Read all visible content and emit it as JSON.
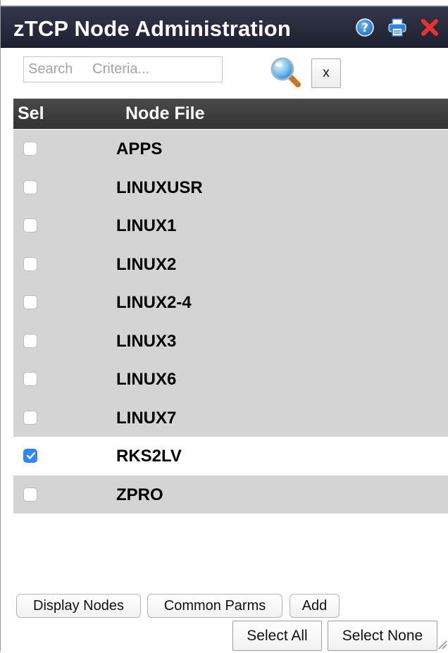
{
  "window": {
    "title": "zTCP Node Administration",
    "titlebar_icons": [
      "help-icon",
      "print-icon",
      "close-icon"
    ]
  },
  "search": {
    "placeholder": "Search     Criteria...",
    "value": "",
    "clear_label": "x"
  },
  "grid": {
    "columns": [
      "Sel",
      "Node File"
    ],
    "rows": [
      {
        "node": "APPS",
        "selected": false
      },
      {
        "node": "LINUXUSR",
        "selected": false
      },
      {
        "node": "LINUX1",
        "selected": false
      },
      {
        "node": "LINUX2",
        "selected": false
      },
      {
        "node": "LINUX2-4",
        "selected": false
      },
      {
        "node": "LINUX3",
        "selected": false
      },
      {
        "node": "LINUX6",
        "selected": false
      },
      {
        "node": "LINUX7",
        "selected": false
      },
      {
        "node": "RKS2LV",
        "selected": true
      },
      {
        "node": "ZPRO",
        "selected": false
      }
    ]
  },
  "buttons": {
    "display_nodes": "Display Nodes",
    "common_parms": "Common Parms",
    "add": "Add",
    "select_all": "Select All",
    "select_none": "Select None"
  },
  "colors": {
    "titlebar": "#262a3b",
    "header": "#3d3d3d",
    "row": "#d4d4d4",
    "row_selected": "#ffffff",
    "checkbox_checked": "#2f86f6",
    "close": "#e8332d",
    "help": "#2f86d8"
  }
}
